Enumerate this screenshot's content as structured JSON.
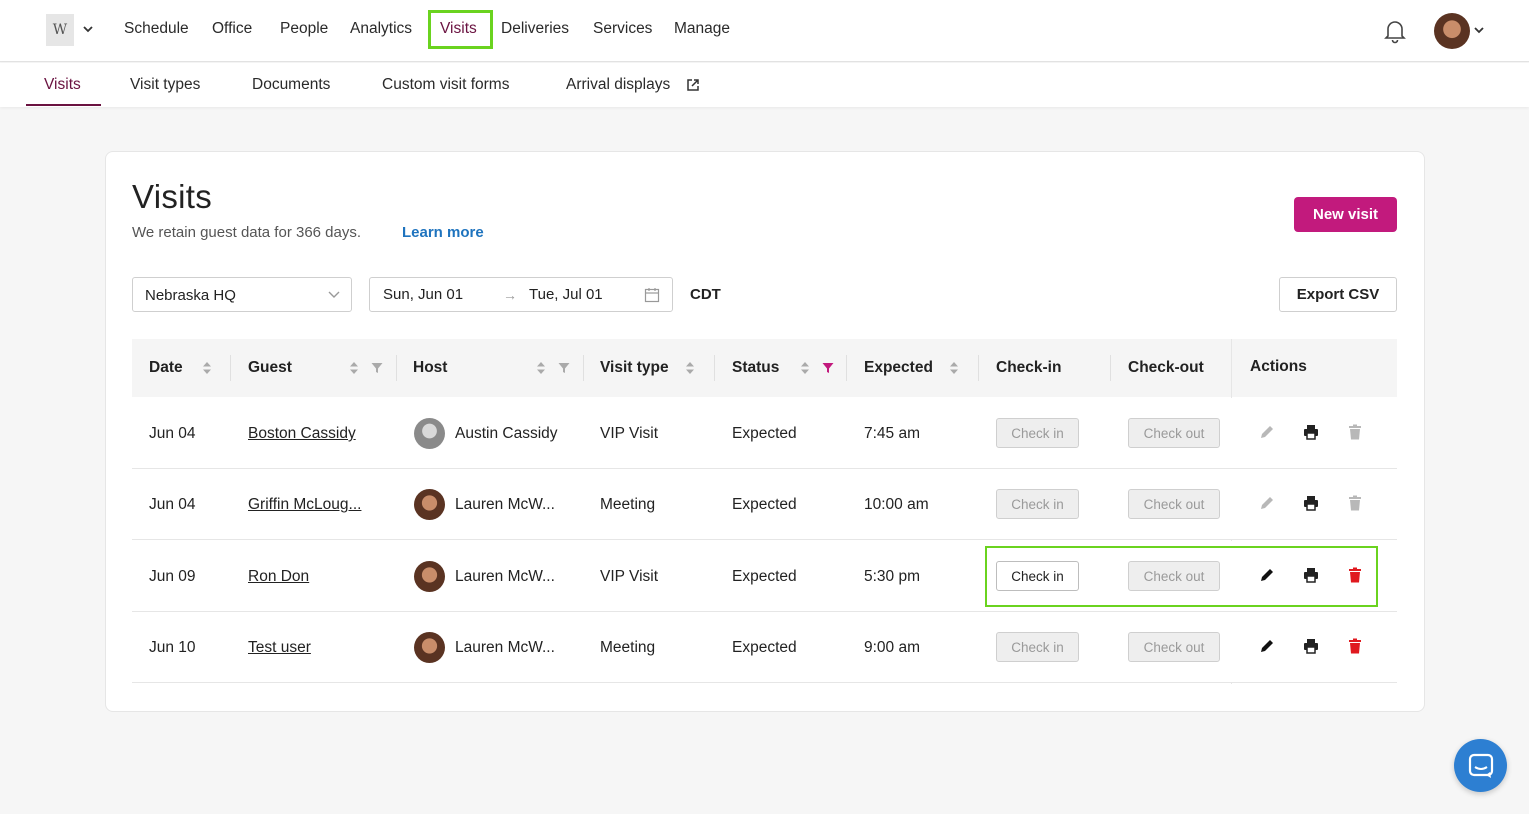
{
  "top_nav": {
    "logo_text": "W",
    "items": [
      "Schedule",
      "Office",
      "People",
      "Analytics",
      "Visits",
      "Deliveries",
      "Services",
      "Manage"
    ],
    "active": "Visits"
  },
  "sub_nav": {
    "items": [
      "Visits",
      "Visit types",
      "Documents",
      "Custom visit forms",
      "Arrival displays"
    ],
    "active": "Visits"
  },
  "page": {
    "title": "Visits",
    "retention_text": "We retain guest data for 366 days.",
    "learn_more": "Learn more",
    "new_visit_label": "New visit",
    "export_label": "Export CSV"
  },
  "filters": {
    "location": "Nebraska HQ",
    "date_start": "Sun, Jun 01",
    "date_arrow": "→",
    "date_end": "Tue, Jul 01",
    "timezone": "CDT"
  },
  "table": {
    "headers": [
      "Date",
      "Guest",
      "Host",
      "Visit type",
      "Status",
      "Expected",
      "Check-in",
      "Check-out",
      "Actions"
    ],
    "rows": [
      {
        "date": "Jun 04",
        "guest": "Boston Cassidy",
        "host": "Austin Cassidy",
        "visit_type": "VIP Visit",
        "status": "Expected",
        "expected": "7:45 am",
        "check_in": "Check in",
        "check_out": "Check out",
        "actions_enabled": false,
        "check_in_enabled": false
      },
      {
        "date": "Jun 04",
        "guest": "Griffin McLoug...",
        "host": "Lauren McW...",
        "visit_type": "Meeting",
        "status": "Expected",
        "expected": "10:00 am",
        "check_in": "Check in",
        "check_out": "Check out",
        "actions_enabled": false,
        "check_in_enabled": false
      },
      {
        "date": "Jun 09",
        "guest": "Ron Don",
        "host": "Lauren McW...",
        "visit_type": "VIP Visit",
        "status": "Expected",
        "expected": "5:30 pm",
        "check_in": "Check in",
        "check_out": "Check out",
        "actions_enabled": true,
        "check_in_enabled": true
      },
      {
        "date": "Jun 10",
        "guest": "Test user",
        "host": "Lauren McW...",
        "visit_type": "Meeting",
        "status": "Expected",
        "expected": "9:00 am",
        "check_in": "Check in",
        "check_out": "Check out",
        "actions_enabled": true,
        "check_in_enabled": false
      }
    ]
  },
  "colors": {
    "brand": "#c21a7d",
    "active_subnav": "#6a1240",
    "link": "#1e73be",
    "highlight": "#6ad31f",
    "delete_active": "#e0191f",
    "chat": "#2d7fd2"
  },
  "icons": [
    "chevron-down-icon",
    "bell-icon",
    "external-link-icon",
    "calendar-icon",
    "sort-icon",
    "filter-icon",
    "pencil-icon",
    "printer-icon",
    "trash-icon",
    "chat-icon"
  ]
}
